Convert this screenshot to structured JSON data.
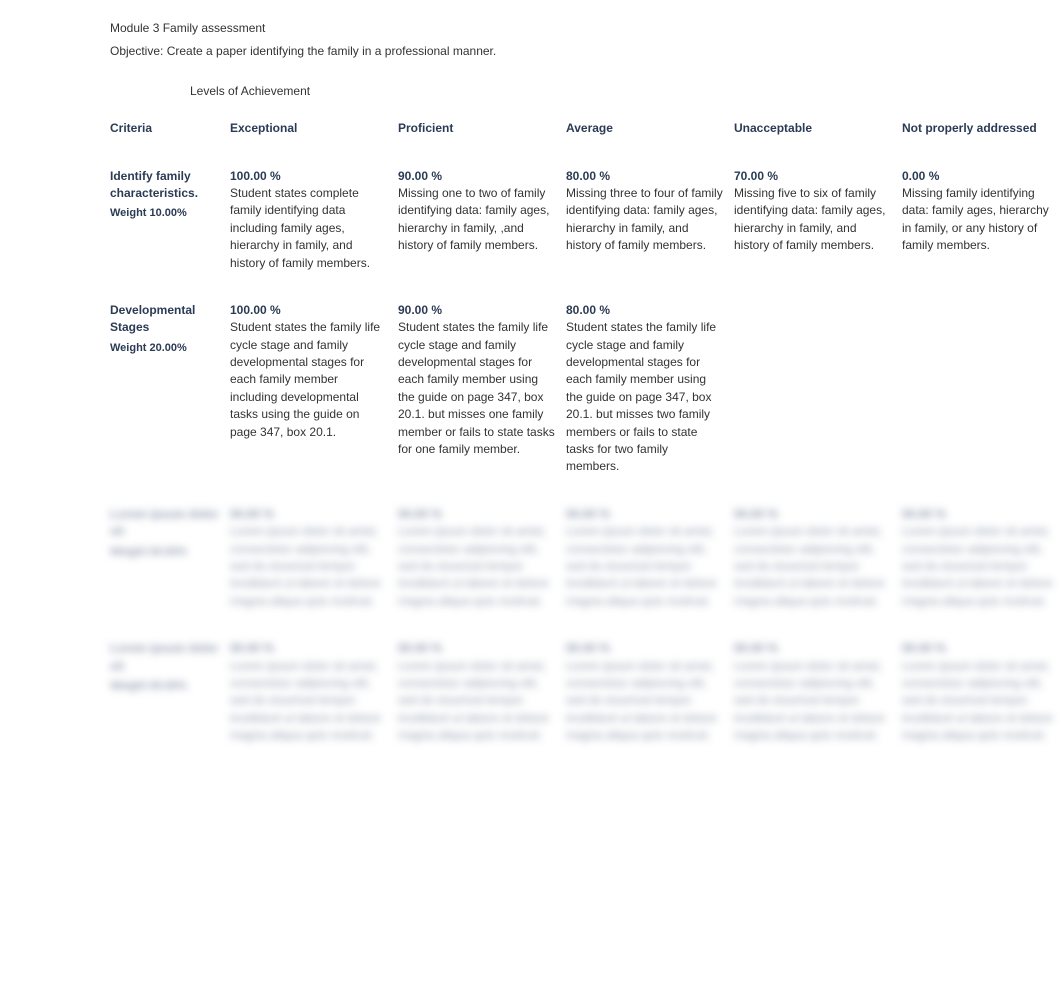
{
  "header": {
    "title": "Module 3 Family assessment",
    "objective": "Objective: Create a paper identifying the family in a professional manner."
  },
  "levels_label": "Levels of Achievement",
  "columns": {
    "criteria": "Criteria",
    "levels": [
      "Exceptional",
      "Proficient",
      "Average",
      "Unacceptable",
      "Not properly addressed"
    ]
  },
  "rows": [
    {
      "criteria": "Identify family characteristics.",
      "weight": "Weight 10.00%",
      "cells": [
        {
          "pct": "100.00 %",
          "text": "Student states complete family identifying data including family ages, hierarchy in family, and history of family members."
        },
        {
          "pct": "90.00 %",
          "text": "Missing one to two of family identifying data: family ages, hierarchy in family, ,and history of family members."
        },
        {
          "pct": "80.00 %",
          "text": "Missing three to four of family identifying data: family ages, hierarchy in family, and history of family members."
        },
        {
          "pct": "70.00 %",
          "text": "Missing five to six of family identifying data: family ages, hierarchy in family, and history of family members."
        },
        {
          "pct": "0.00 %",
          "text": "Missing family identifying data: family ages, hierarchy in family, or any history of family members."
        }
      ]
    },
    {
      "criteria": "Developmental Stages",
      "weight": "Weight 20.00%",
      "cells": [
        {
          "pct": "100.00 %",
          "text": "Student states the family life cycle stage and family developmental stages for each family member including developmental tasks using the guide on page 347, box 20.1."
        },
        {
          "pct": "90.00 %",
          "text": "Student states the family life cycle stage and family developmental stages for each family member using the guide on page 347, box 20.1. but misses one family member or fails to state tasks for one family member."
        },
        {
          "pct": "80.00 %",
          "text": "Student states the family life cycle stage and family developmental stages for each family member using the guide on page 347, box 20.1. but misses two family members or fails to state tasks for two family members."
        },
        {
          "pct": "",
          "text": ""
        },
        {
          "pct": "",
          "text": ""
        }
      ]
    },
    {
      "criteria": "",
      "weight": "",
      "cells": [
        {
          "pct": "",
          "text": ""
        },
        {
          "pct": "",
          "text": ""
        },
        {
          "pct": "",
          "text": ""
        },
        {
          "pct": "",
          "text": ""
        },
        {
          "pct": "",
          "text": ""
        }
      ],
      "masked": true
    },
    {
      "criteria": "",
      "weight": "",
      "cells": [
        {
          "pct": "",
          "text": ""
        },
        {
          "pct": "",
          "text": ""
        },
        {
          "pct": "",
          "text": ""
        },
        {
          "pct": "",
          "text": ""
        },
        {
          "pct": "",
          "text": ""
        }
      ],
      "masked": true
    }
  ],
  "mask_placeholder": {
    "criteria": "Lorem ipsum dolor sit",
    "weight": "Weight 00.00%",
    "pct": "00.00 %",
    "text": "Lorem ipsum dolor sit amet, consectetur adipiscing elit, sed do eiusmod tempor incididunt ut labore et dolore magna aliqua quis nostrud."
  }
}
